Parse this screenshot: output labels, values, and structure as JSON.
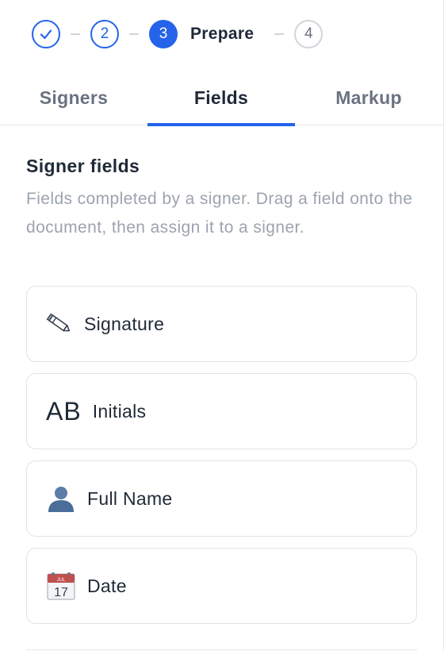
{
  "stepper": {
    "steps": [
      {
        "number": "✓",
        "state": "done"
      },
      {
        "number": "2",
        "state": "pending"
      },
      {
        "number": "3",
        "state": "active",
        "label": "Prepare"
      },
      {
        "number": "4",
        "state": "future"
      }
    ]
  },
  "tabs": [
    {
      "label": "Signers",
      "active": false
    },
    {
      "label": "Fields",
      "active": true
    },
    {
      "label": "Markup",
      "active": false
    }
  ],
  "signer_fields": {
    "title": "Signer fields",
    "description": "Fields completed by a signer. Drag a field onto the document, then assign it to a signer.",
    "items": [
      {
        "label": "Signature",
        "icon": "pencil-icon"
      },
      {
        "label": "Initials",
        "icon": "initials-icon",
        "icon_text": "AB"
      },
      {
        "label": "Full Name",
        "icon": "person-icon"
      },
      {
        "label": "Date",
        "icon": "calendar-icon",
        "icon_month": "JUL",
        "icon_day": "17"
      }
    ]
  },
  "colors": {
    "accent": "#2563eb",
    "muted_text": "#9ca3af",
    "border": "#dfe3ea"
  }
}
